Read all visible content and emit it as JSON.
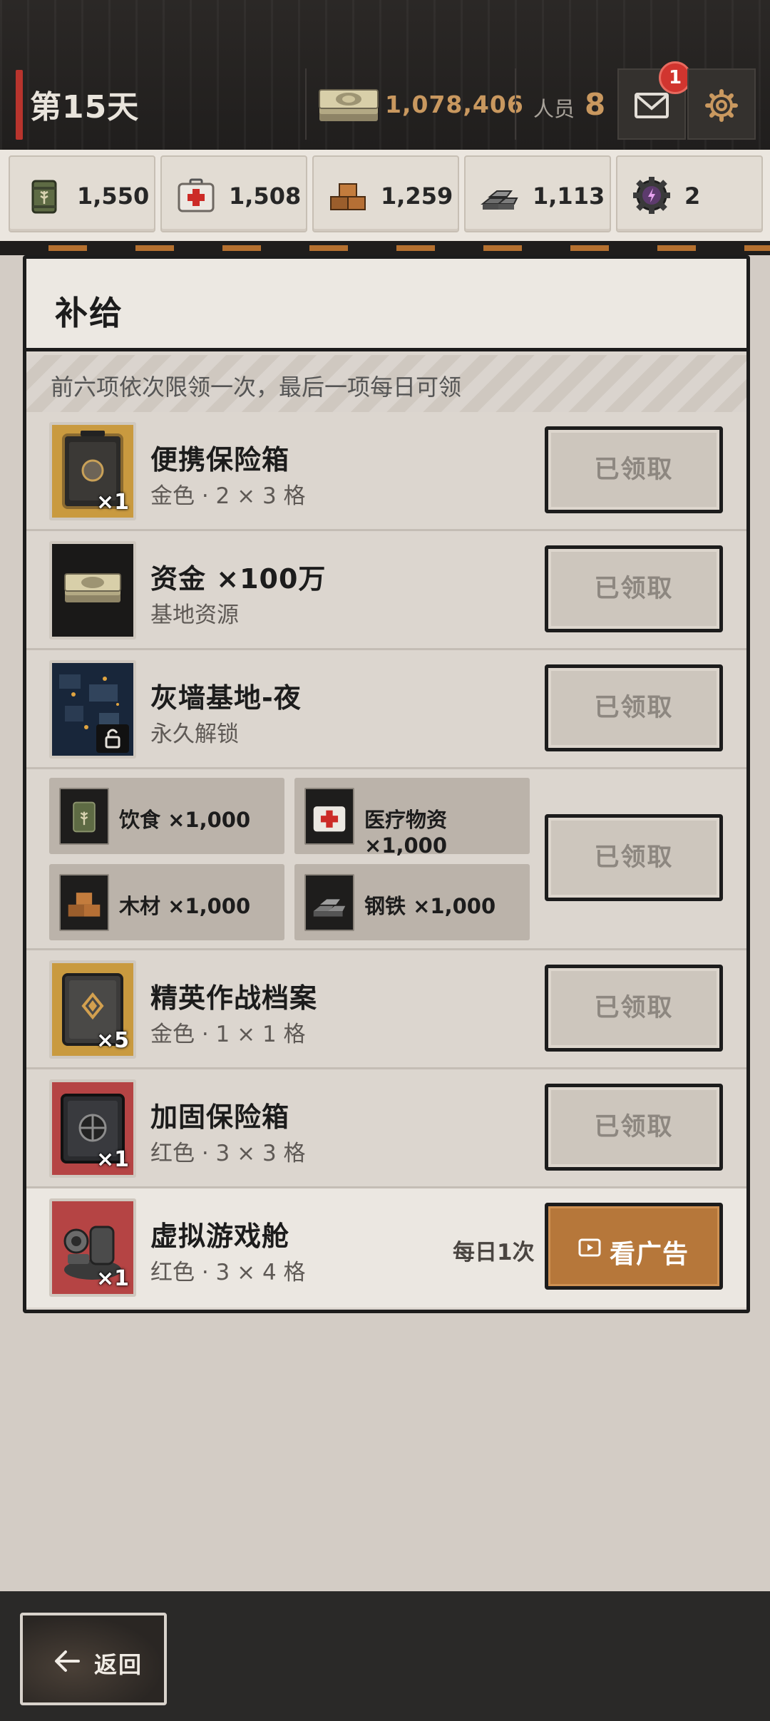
{
  "header": {
    "day": "第15天",
    "money": "1,078,406",
    "staff_label": "人员",
    "staff_count": "8",
    "mail_badge": "1"
  },
  "resources": [
    {
      "name": "food-icon",
      "value": "1,550"
    },
    {
      "name": "medical-icon",
      "value": "1,508"
    },
    {
      "name": "wood-icon",
      "value": "1,259"
    },
    {
      "name": "steel-icon",
      "value": "1,113"
    },
    {
      "name": "gear-token-icon",
      "value": "2"
    }
  ],
  "panel": {
    "title": "补给",
    "notice": "前六项依次限领一次，最后一项每日可领",
    "claimed_label": "已领取",
    "items": [
      {
        "name": "便携保险箱",
        "sub": "金色 · 2 × 3 格",
        "qty": "×1"
      },
      {
        "name": "资金 ×100万",
        "sub": "基地资源"
      },
      {
        "name": "灰墙基地-夜",
        "sub": "永久解锁"
      },
      {
        "bundle": [
          "饮食 ×1,000",
          "医疗物资 ×1,000",
          "木材 ×1,000",
          "钢铁 ×1,000"
        ]
      },
      {
        "name": "精英作战档案",
        "sub": "金色 · 1 × 1 格",
        "qty": "×5"
      },
      {
        "name": "加固保险箱",
        "sub": "红色 · 3 × 3 格",
        "qty": "×1"
      },
      {
        "name": "虚拟游戏舱",
        "sub": "红色 · 3 × 4 格",
        "qty": "×1",
        "daily": "每日1次",
        "ad_label": "看广告"
      }
    ]
  },
  "footer": {
    "back_label": "返回"
  },
  "colors": {
    "accent": "#b6773a",
    "gold": "#c9985f",
    "badge": "#d1352f"
  }
}
